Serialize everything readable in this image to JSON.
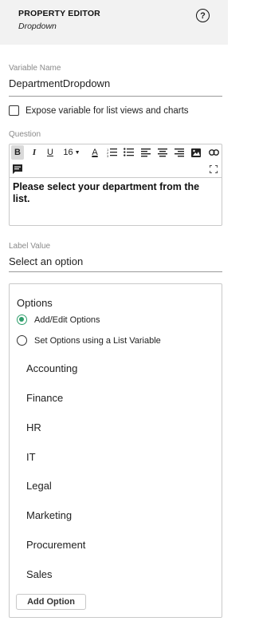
{
  "header": {
    "title": "PROPERTY EDITOR",
    "subtitle": "Dropdown",
    "help_label": "?"
  },
  "variable_name": {
    "label": "Variable Name",
    "value": "DepartmentDropdown"
  },
  "expose_option": {
    "label": "Expose variable for list views and charts",
    "checked": false
  },
  "question": {
    "label": "Question",
    "toolbar": {
      "bold": "B",
      "italic": "I",
      "underline": "U",
      "font_size": "16",
      "font_color": "A"
    },
    "content": "Please select your department from the list."
  },
  "label_value": {
    "label": "Label Value",
    "value": "Select an option"
  },
  "options": {
    "title": "Options",
    "modes": [
      {
        "label": "Add/Edit Options",
        "selected": true
      },
      {
        "label": "Set Options using a List Variable",
        "selected": false
      }
    ],
    "items": [
      "Accounting",
      "Finance",
      "HR",
      "IT",
      "Legal",
      "Marketing",
      "Procurement",
      "Sales"
    ],
    "add_button": "Add Option"
  },
  "colors": {
    "accent": "#2e9e6b",
    "header_bg": "#f2f2f2",
    "border": "#c9c9c9"
  }
}
